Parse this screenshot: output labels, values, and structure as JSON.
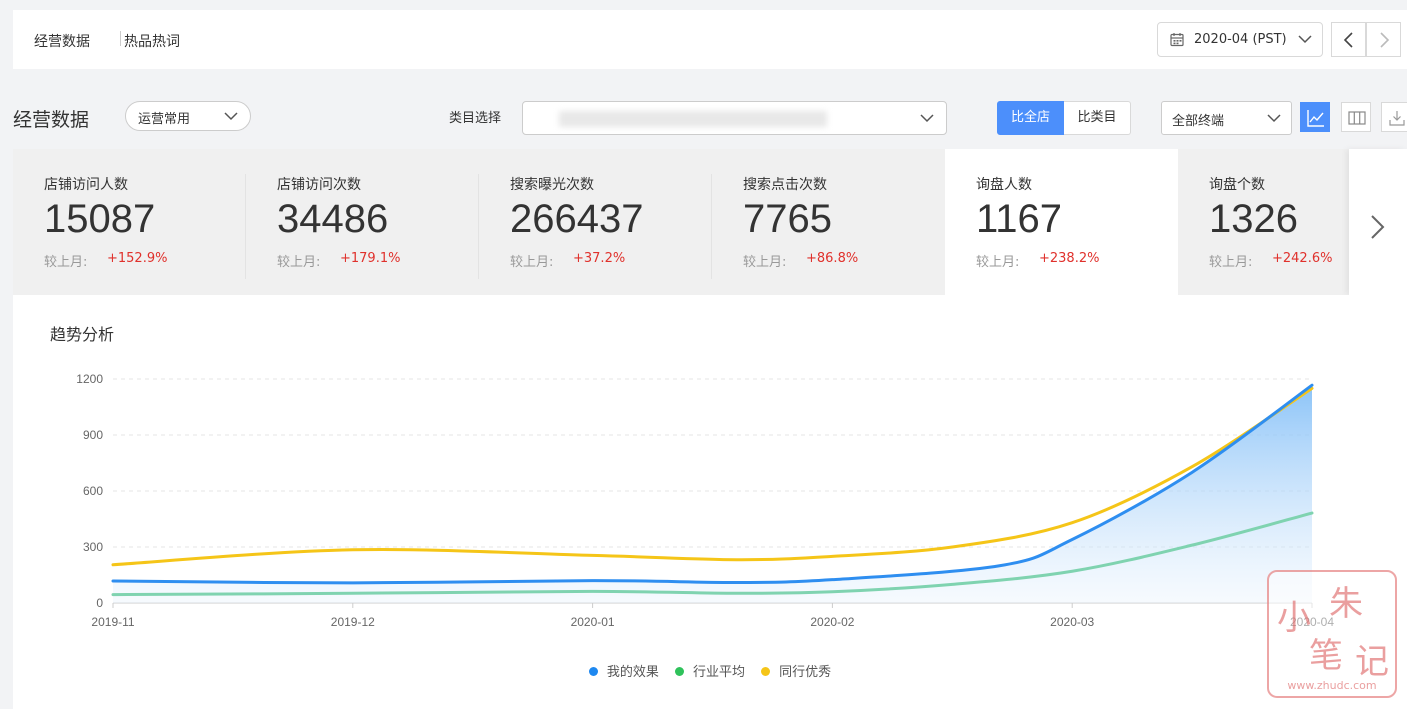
{
  "nav": {
    "tabs": [
      "经营数据",
      "热品热词"
    ],
    "date": "2020-04 (PST)"
  },
  "filters": {
    "section_title": "经营数据",
    "ops_select": "运营常用",
    "category_label": "类目选择",
    "compare_store": "比全店",
    "compare_category": "比类目",
    "terminal": "全部终端"
  },
  "kpis": [
    {
      "label": "店铺访问人数",
      "value": "15087",
      "compare_label": "较上月:",
      "change": "+152.9%"
    },
    {
      "label": "店铺访问次数",
      "value": "34486",
      "compare_label": "较上月:",
      "change": "+179.1%"
    },
    {
      "label": "搜索曝光次数",
      "value": "266437",
      "compare_label": "较上月:",
      "change": "+37.2%"
    },
    {
      "label": "搜索点击次数",
      "value": "7765",
      "compare_label": "较上月:",
      "change": "+86.8%"
    },
    {
      "label": "询盘人数",
      "value": "1167",
      "compare_label": "较上月:",
      "change": "+238.2%"
    },
    {
      "label": "询盘个数",
      "value": "1326",
      "compare_label": "较上月:",
      "change": "+242.6%"
    }
  ],
  "chart_title": "趋势分析",
  "chart_data": {
    "type": "line",
    "x": [
      "2019-11",
      "2019-12",
      "2020-01",
      "2020-02",
      "2020-03",
      "2020-04"
    ],
    "yticks": [
      0,
      300,
      600,
      900,
      1200
    ],
    "ylim": [
      0,
      1200
    ],
    "grid": true,
    "legend": "bottom",
    "series": [
      {
        "name": "我的效果",
        "color": "#2e8ef0",
        "area": true,
        "points": [
          [
            0,
            118
          ],
          [
            1,
            108
          ],
          [
            2,
            120
          ],
          [
            2.6,
            110
          ],
          [
            3,
            125
          ],
          [
            3.7,
            200
          ],
          [
            4,
            340
          ],
          [
            4.5,
            700
          ],
          [
            5,
            1167
          ]
        ]
      },
      {
        "name": "行业平均",
        "color": "#7fd3b0",
        "points": [
          [
            0,
            45
          ],
          [
            1,
            52
          ],
          [
            2,
            62
          ],
          [
            2.6,
            52
          ],
          [
            3,
            60
          ],
          [
            3.5,
            100
          ],
          [
            4,
            170
          ],
          [
            4.5,
            310
          ],
          [
            5,
            482
          ]
        ]
      },
      {
        "name": "同行优秀",
        "color": "#f5c518",
        "points": [
          [
            0,
            205
          ],
          [
            1,
            285
          ],
          [
            2,
            255
          ],
          [
            2.6,
            232
          ],
          [
            3,
            250
          ],
          [
            3.5,
            300
          ],
          [
            4,
            430
          ],
          [
            4.5,
            730
          ],
          [
            5,
            1150
          ]
        ]
      }
    ]
  },
  "watermark": {
    "chars": [
      "小",
      "朱",
      "笔",
      "记"
    ],
    "site": "www.zhudc.com"
  }
}
